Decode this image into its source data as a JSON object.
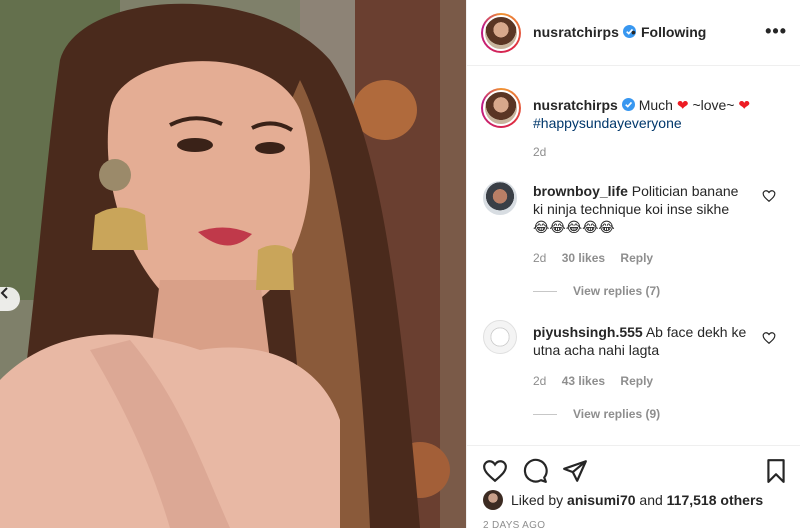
{
  "post": {
    "username": "nusratchirps",
    "follow_dot": "•",
    "follow_status": "Following",
    "more_label": "•••",
    "caption_text_1": "Much",
    "caption_text_2": "~love~",
    "caption_heart": "❤",
    "hashtag": "#happysundayeveryone",
    "time": "2d",
    "liked_by_prefix": "Liked by",
    "liked_by_user": "anisumi70",
    "liked_by_and": "and",
    "likes_count": "117,518 others",
    "ago": "2 DAYS AGO"
  },
  "comments": [
    {
      "username": "brownboy_life",
      "text": "Politician banane ki ninja technique koi inse sikhe",
      "emojis": "😂😂😂😂😂",
      "time": "2d",
      "likes": "30 likes",
      "reply": "Reply",
      "view_replies": "View replies (7)"
    },
    {
      "username": "piyushsingh.555",
      "text": "Ab face dekh ke utna acha nahi lagta",
      "emojis": "",
      "time": "2d",
      "likes": "43 likes",
      "reply": "Reply",
      "view_replies": "View replies (9)"
    }
  ],
  "icons": {
    "verified": "verified-badge-icon",
    "like": "heart-outline-icon",
    "comment": "comment-bubble-icon",
    "share": "paper-plane-icon",
    "save": "bookmark-icon",
    "prev": "chevron-left-icon"
  },
  "colors": {
    "verified_blue": "#3897f0",
    "hashtag": "#00376b",
    "heart_red": "#ed1c24",
    "meta_gray": "#8e8e8e"
  }
}
